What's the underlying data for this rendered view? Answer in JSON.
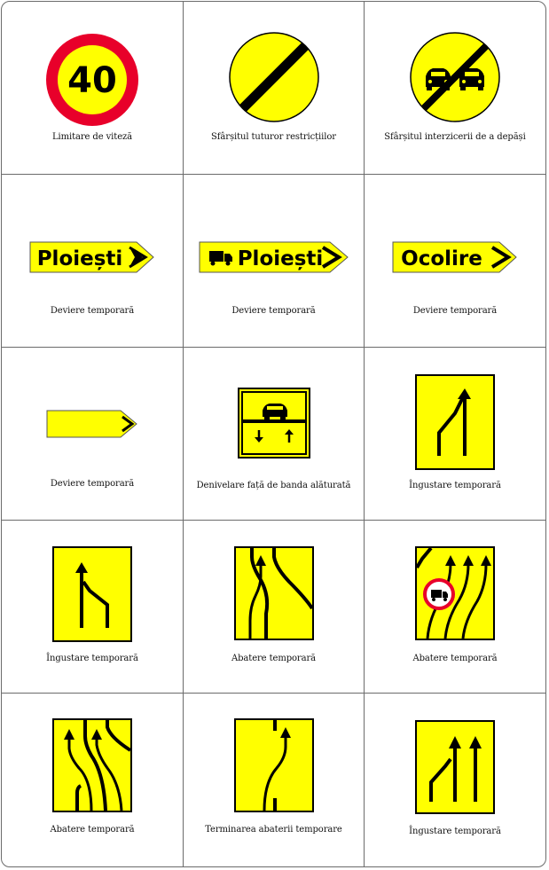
{
  "signs": [
    {
      "caption": "Limitare de viteză",
      "number": "40",
      "icon": "speed-limit-40-sign"
    },
    {
      "caption": "Sfârșitul tuturor restricțiilor",
      "icon": "end-of-all-restrictions-sign"
    },
    {
      "caption": "Sfârșitul interzicerii de a depăși",
      "icon": "end-of-no-overtaking-sign"
    },
    {
      "caption": "Deviere temporară",
      "text": "Ploiești",
      "icon": "detour-direction-sign"
    },
    {
      "caption": "Deviere temporară",
      "text": "Ploiești",
      "icon": "detour-truck-direction-sign"
    },
    {
      "caption": "Deviere temporară",
      "text": "Ocolire",
      "icon": "detour-bypass-sign"
    },
    {
      "caption": "Deviere temporară",
      "icon": "detour-arrow-sign"
    },
    {
      "caption": "Denivelare față de banda alăturată",
      "icon": "uneven-adjacent-lane-sign"
    },
    {
      "caption": "Îngustare temporară",
      "icon": "lane-narrowing-right-merge-sign"
    },
    {
      "caption": "Îngustare temporară",
      "icon": "lane-narrowing-left-keep-sign"
    },
    {
      "caption": "Abatere temporară",
      "icon": "temporary-deviation-sign"
    },
    {
      "caption": "Abatere temporară",
      "icon": "temporary-deviation-no-trucks-sign"
    },
    {
      "caption": "Abatere temporară",
      "icon": "temporary-deviation-three-lanes-sign"
    },
    {
      "caption": "Terminarea abaterii temporare",
      "icon": "end-of-temporary-deviation-sign"
    },
    {
      "caption": "Îngustare temporară",
      "icon": "lane-narrowing-three-to-two-sign"
    }
  ],
  "colors": {
    "yellow": "#ffff00",
    "red": "#e8002a",
    "black": "#000000",
    "border": "#6b6b6b"
  }
}
